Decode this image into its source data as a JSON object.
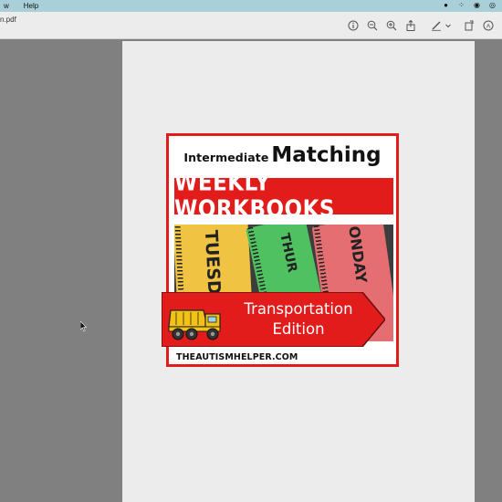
{
  "menu": {
    "items": [
      "w",
      "Help"
    ]
  },
  "document": {
    "filename": "n.pdf"
  },
  "toolbar": {
    "icons": [
      "info-icon",
      "zoom-out-icon",
      "zoom-in-icon",
      "share-icon",
      "markup-icon",
      "chevron-down-icon",
      "rotate-icon",
      "annotate-icon"
    ]
  },
  "cover": {
    "title_small": "Intermediate",
    "title_big": "Matching",
    "banner": "WEEKLY WORKBOOKS",
    "book_labels": [
      "TUESDA",
      "THUR",
      "ONDAY"
    ],
    "edition_line1": "Transportation",
    "edition_line2": "Edition",
    "website": "THEAUTISMHELPER.COM"
  },
  "colors": {
    "accent_red": "#e21b1b",
    "menubar": "#a9cfd9",
    "book_yellow": "#f0c342",
    "book_green": "#4fc160",
    "book_red": "#e46e72"
  }
}
